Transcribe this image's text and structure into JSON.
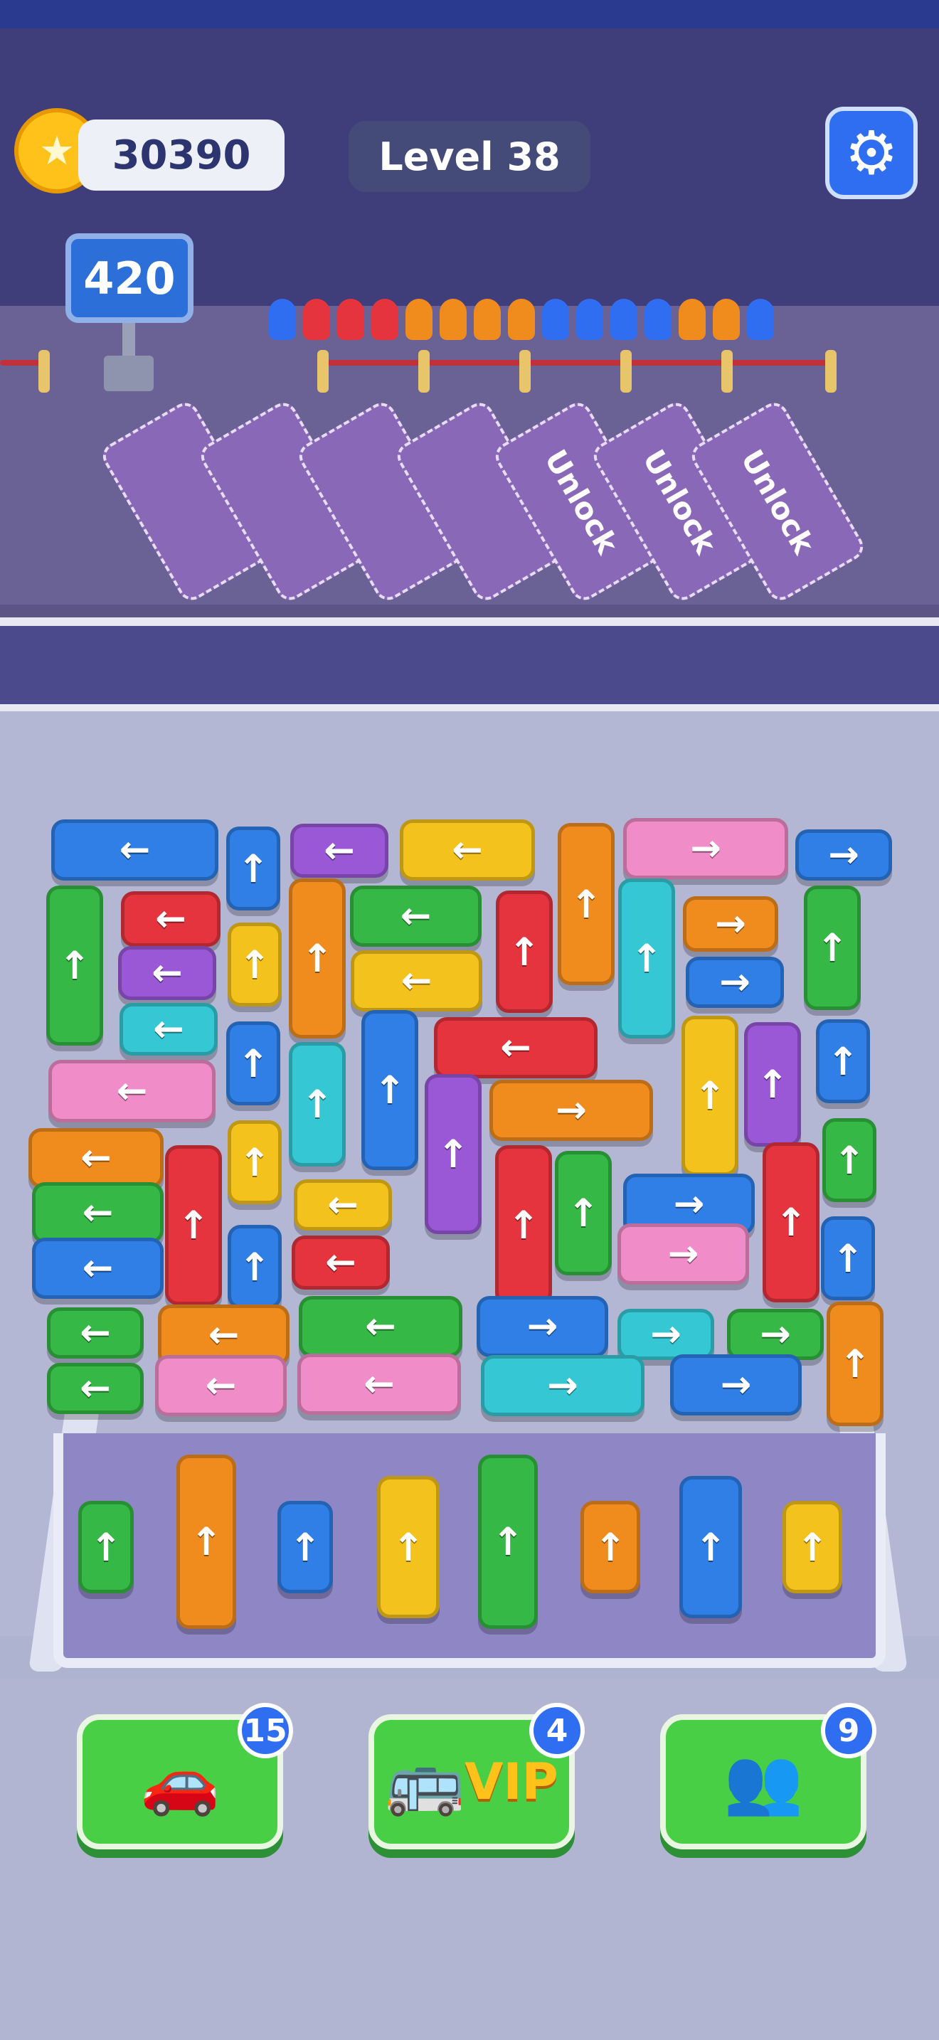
{
  "hud": {
    "coins": "30390",
    "level": "Level 38",
    "counter": "420",
    "coin_icon": "star-coin-icon",
    "settings_icon": "gear-icon"
  },
  "parking_slots": [
    {
      "label": ""
    },
    {
      "label": ""
    },
    {
      "label": ""
    },
    {
      "label": ""
    },
    {
      "label": "Unlock"
    },
    {
      "label": "Unlock"
    },
    {
      "label": "Unlock"
    }
  ],
  "queue_colors": [
    "#2f6ef0",
    "#e5343e",
    "#e5343e",
    "#e5343e",
    "#f08c1e",
    "#f08c1e",
    "#f08c1e",
    "#f08c1e",
    "#2f6ef0",
    "#2f6ef0",
    "#2f6ef0",
    "#2f6ef0",
    "#f08c1e",
    "#f08c1e",
    "#2f6ef0"
  ],
  "colors": {
    "blue": "#2f7fe6",
    "red": "#e5343e",
    "orange": "#f08c1e",
    "green": "#35b845",
    "yellow": "#f4c21c",
    "pink": "#f08cc8",
    "purple": "#9a58d6",
    "cyan": "#35c8d4"
  },
  "board_cars": [
    {
      "color": "blue",
      "arrow": "←"
    },
    {
      "color": "blue",
      "arrow": "↑"
    },
    {
      "color": "purple",
      "arrow": "←"
    },
    {
      "color": "yellow",
      "arrow": "←"
    },
    {
      "color": "orange",
      "arrow": "↑"
    },
    {
      "color": "pink",
      "arrow": "→"
    },
    {
      "color": "blue",
      "arrow": "→"
    },
    {
      "color": "green",
      "arrow": "↑"
    },
    {
      "color": "red",
      "arrow": "←"
    },
    {
      "color": "yellow",
      "arrow": "↑"
    },
    {
      "color": "orange",
      "arrow": "↑"
    },
    {
      "color": "green",
      "arrow": "←"
    },
    {
      "color": "red",
      "arrow": "↑"
    },
    {
      "color": "cyan",
      "arrow": "↑"
    },
    {
      "color": "orange",
      "arrow": "→"
    },
    {
      "color": "green",
      "arrow": "↑"
    },
    {
      "color": "purple",
      "arrow": "←"
    },
    {
      "color": "yellow",
      "arrow": "←"
    },
    {
      "color": "blue",
      "arrow": "→"
    },
    {
      "color": "cyan",
      "arrow": "←"
    },
    {
      "color": "blue",
      "arrow": "↑"
    },
    {
      "color": "cyan",
      "arrow": "↑"
    },
    {
      "color": "blue",
      "arrow": "↑"
    },
    {
      "color": "red",
      "arrow": "←"
    },
    {
      "color": "yellow",
      "arrow": "↑"
    },
    {
      "color": "purple",
      "arrow": "↑"
    },
    {
      "color": "blue",
      "arrow": "↑"
    },
    {
      "color": "pink",
      "arrow": "←"
    },
    {
      "color": "purple",
      "arrow": "↑"
    },
    {
      "color": "orange",
      "arrow": "→"
    },
    {
      "color": "orange",
      "arrow": "←"
    },
    {
      "color": "red",
      "arrow": "↑"
    },
    {
      "color": "yellow",
      "arrow": "↑"
    },
    {
      "color": "red",
      "arrow": "↑"
    },
    {
      "color": "green",
      "arrow": "↑"
    },
    {
      "color": "red",
      "arrow": "↑"
    },
    {
      "color": "green",
      "arrow": "↑"
    },
    {
      "color": "green",
      "arrow": "←"
    },
    {
      "color": "yellow",
      "arrow": "←"
    },
    {
      "color": "blue",
      "arrow": "→"
    },
    {
      "color": "blue",
      "arrow": "←"
    },
    {
      "color": "blue",
      "arrow": "↑"
    },
    {
      "color": "red",
      "arrow": "←"
    },
    {
      "color": "pink",
      "arrow": "→"
    },
    {
      "color": "blue",
      "arrow": "↑"
    },
    {
      "color": "green",
      "arrow": "←"
    },
    {
      "color": "orange",
      "arrow": "←"
    },
    {
      "color": "green",
      "arrow": "←"
    },
    {
      "color": "blue",
      "arrow": "→"
    },
    {
      "color": "cyan",
      "arrow": "→"
    },
    {
      "color": "green",
      "arrow": "→"
    },
    {
      "color": "orange",
      "arrow": "↑"
    },
    {
      "color": "green",
      "arrow": "←"
    },
    {
      "color": "pink",
      "arrow": "←"
    },
    {
      "color": "pink",
      "arrow": "←"
    },
    {
      "color": "cyan",
      "arrow": "→"
    },
    {
      "color": "blue",
      "arrow": "→"
    }
  ],
  "tray_cars": [
    {
      "color": "green",
      "arrow": "↑"
    },
    {
      "color": "orange",
      "arrow": "↑"
    },
    {
      "color": "blue",
      "arrow": "↑"
    },
    {
      "color": "yellow",
      "arrow": "↑"
    },
    {
      "color": "green",
      "arrow": "↑"
    },
    {
      "color": "orange",
      "arrow": "↑"
    },
    {
      "color": "blue",
      "arrow": "↑"
    },
    {
      "color": "yellow",
      "arrow": "↑"
    }
  ],
  "boosters": [
    {
      "name": "shuffle-car",
      "count": "15",
      "icon": "car-swap-icon"
    },
    {
      "name": "vip",
      "count": "4",
      "icon": "vip-bus-icon",
      "text": "VIP"
    },
    {
      "name": "swap-passengers",
      "count": "9",
      "icon": "people-swap-icon"
    }
  ]
}
